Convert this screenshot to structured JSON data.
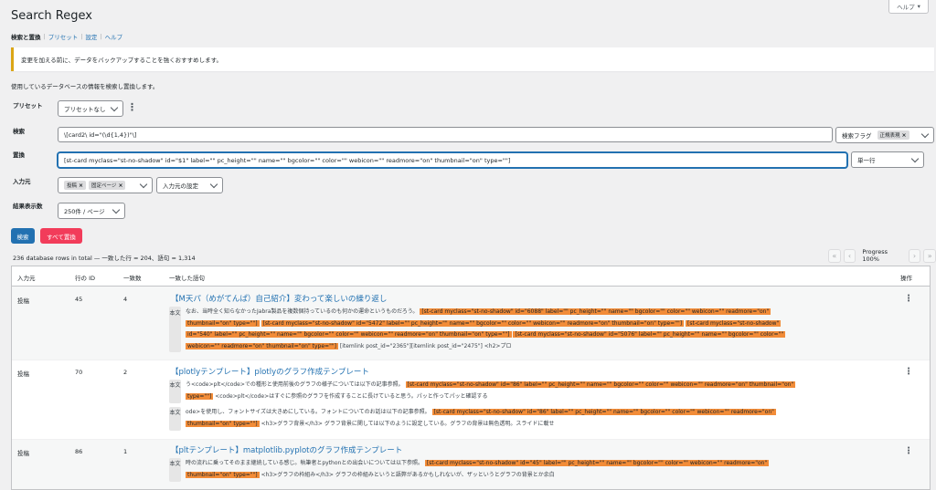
{
  "header": {
    "title": "Search Regex",
    "help": "ヘルプ"
  },
  "subnav": [
    {
      "label": "検索と置換",
      "current": true
    },
    {
      "label": "プリセット",
      "current": false
    },
    {
      "label": "設定",
      "current": false
    },
    {
      "label": "ヘルプ",
      "current": false
    }
  ],
  "notice": "変更を加える前に、データをバックアップすることを強くおすすめします。",
  "intro": "使用しているデータベースの情報を検索し置換します。",
  "form": {
    "preset_label": "プリセット",
    "preset_value": "プリセットなし",
    "search_label": "検索",
    "search_value": "\\[card2\\ id=\"(\\d{1,4})\"\\]",
    "flags_label": "検索フラグ",
    "flags_tag": "正規表現",
    "replace_label": "置換",
    "replace_value": "[st-card myclass=\"st-no-shadow\" id=\"$1\" label=\"\" pc_height=\"\" name=\"\" bgcolor=\"\" color=\"\" webicon=\"\" readmore=\"on\" thumbnail=\"on\" type=\"\"]",
    "replace_mode": "単一行",
    "source_label": "入力元",
    "source_tags": [
      "投稿",
      "固定ページ"
    ],
    "source_settings": "入力元の設定",
    "results_label": "結果表示数",
    "results_value": "250件 / ページ",
    "search_button": "検索",
    "replace_all_button": "すべて置換"
  },
  "results": {
    "summary": "236 database rows in total — 一致した行 = 204、語句 = 1,314",
    "progress": "Progress 100%",
    "headers": {
      "source": "入力元",
      "row_id": "行の ID",
      "match_count": "一致数",
      "matched": "一致した語句",
      "actions": "操作"
    },
    "rows": [
      {
        "source": "投稿",
        "id": "45",
        "count": "4",
        "title": "【M天パ（めがてんぱ）自己紹介】変わって楽しいの繰り返し",
        "badge": "本文",
        "line1_text": "なお、当時全く知らなかったJabra製品を複数個持っているのも何かの運命というものだろう。",
        "line1_hl": "[st-card myclass=\"st-no-shadow\" id=\"6088\" label=\"\" pc_height=\"\" name=\"\" bgcolor=\"\" color=\"\" webicon=\"\" readmore=\"on\"",
        "line2_hl": "thumbnail=\"on\" type=\"\"]",
        "line2_hl2": "[st-card myclass=\"st-no-shadow\" id=\"5472\" label=\"\" pc_height=\"\" name=\"\" bgcolor=\"\" color=\"\" webicon=\"\" readmore=\"on\" thumbnail=\"on\" type=\"\"]",
        "line2_hl3": "[st-card myclass=\"st-no-shadow\"",
        "line3_hl": "id=\"540\" label=\"\" pc_height=\"\" name=\"\" bgcolor=\"\" color=\"\" webicon=\"\" readmore=\"on\" thumbnail=\"on\" type=\"\"]",
        "line3_hl2": "[st-card myclass=\"st-no-shadow\" id=\"5076\" label=\"\" pc_height=\"\" name=\"\" bgcolor=\"\" color=\"\"",
        "line4_hl": "webicon=\"\" readmore=\"on\" thumbnail=\"on\" type=\"\"]",
        "line4_text": "[itemlink post_id=\"2365\"][itemlink post_id=\"2475\"] <h2>プロ"
      },
      {
        "source": "投稿",
        "id": "70",
        "count": "2",
        "title": "【plotlyテンプレート】plotlyのグラフ作成テンプレート",
        "badge": "本文",
        "a1_text": "う<code>plt</code>での種形と使用前後のグラフの様子については以下の記事参照。",
        "a1_hl": "[st-card myclass=\"st-no-shadow\" id=\"86\" label=\"\" pc_height=\"\" name=\"\" bgcolor=\"\" color=\"\" webicon=\"\" readmore=\"on\" thumbnail=\"on\"",
        "a2_hl": "type=\"\"]",
        "a2_text": "<code>plt</code>はすぐに参照のグラフを作成することに長けていると思う。パッと作ってパッと確認する",
        "badge2": "本文",
        "b1_text": "ode>を使用し、フォントサイズは大きめにしている。フォントについてのお話は以下の記事参照。",
        "b1_hl": "[st-card myclass=\"st-no-shadow\" id=\"86\" label=\"\" pc_height=\"\" name=\"\" bgcolor=\"\" color=\"\" webicon=\"\" readmore=\"on\"",
        "b2_hl": "thumbnail=\"on\" type=\"\"]",
        "b2_text": "<h3>グラフ背景</h3> グラフ背景に関しては以下のように設定している。グラフの背景は無色透明。スライドに載せ"
      },
      {
        "source": "投稿",
        "id": "86",
        "count": "1",
        "title": "【pltテンプレート】matplotlib.pyplotのグラフ作成テンプレート",
        "badge": "本文",
        "c1_text": "時の流れに乗ってそのまま継続している感じ。執筆者とpythonとの出会いについては以下参照。",
        "c1_hl": "[st-card myclass=\"st-no-shadow\" id=\"45\" label=\"\" pc_height=\"\" name=\"\" bgcolor=\"\" color=\"\" webicon=\"\" readmore=\"on\"",
        "c2_hl": "thumbnail=\"on\" type=\"\"]",
        "c2_text": "<h3>グラフの枠組み</h3> グラフの枠組みというと語弊があるかもしれないが、ザッというとグラフの背景とか余白"
      }
    ]
  },
  "colors": {
    "accent": "#2271b1",
    "danger": "#f23c5a",
    "highlight": "#f28c38",
    "notice_border": "#dba617"
  },
  "icons": {
    "kebab": "⋮",
    "first_page": "«",
    "prev_page": "‹",
    "next_page": "›",
    "last_page": "»",
    "remove": "×"
  }
}
